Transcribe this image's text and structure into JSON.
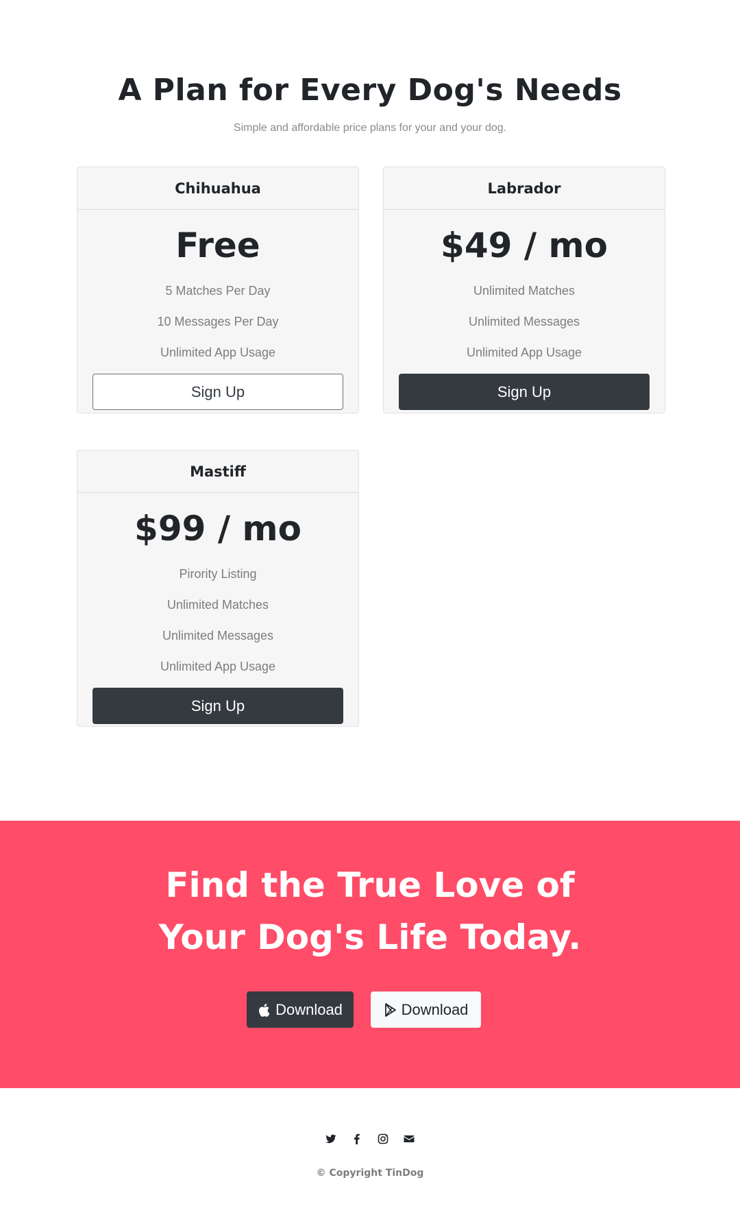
{
  "pricing": {
    "title": "A Plan for Every Dog's Needs",
    "subtitle": "Simple and affordable price plans for your and your dog.",
    "plans": [
      {
        "name": "Chihuahua",
        "price": "Free",
        "features": [
          "5 Matches Per Day",
          "10 Messages Per Day",
          "Unlimited App Usage"
        ],
        "button_label": "Sign Up",
        "button_style": "outline"
      },
      {
        "name": "Labrador",
        "price": "$49 / mo",
        "features": [
          "Unlimited Matches",
          "Unlimited Messages",
          "Unlimited App Usage"
        ],
        "button_label": "Sign Up",
        "button_style": "dark"
      },
      {
        "name": "Mastiff",
        "price": "$99 / mo",
        "features": [
          "Pirority Listing",
          "Unlimited Matches",
          "Unlimited Messages",
          "Unlimited App Usage"
        ],
        "button_label": "Sign Up",
        "button_style": "dark"
      }
    ]
  },
  "cta": {
    "title_line1": "Find the True Love of",
    "title_line2": "Your Dog's Life Today.",
    "apple_button_label": "Download",
    "apple_icon": "apple-icon",
    "play_button_label": "Download",
    "play_icon": "google-play-icon",
    "background_color": "#ff4c68"
  },
  "footer": {
    "social_icons": [
      "twitter-icon",
      "facebook-icon",
      "instagram-icon",
      "envelope-icon"
    ],
    "copyright": "© Copyright TinDog"
  },
  "colors": {
    "dark": "#343a40",
    "accent": "#ff4c68",
    "muted_text": "#7d7d7d"
  }
}
